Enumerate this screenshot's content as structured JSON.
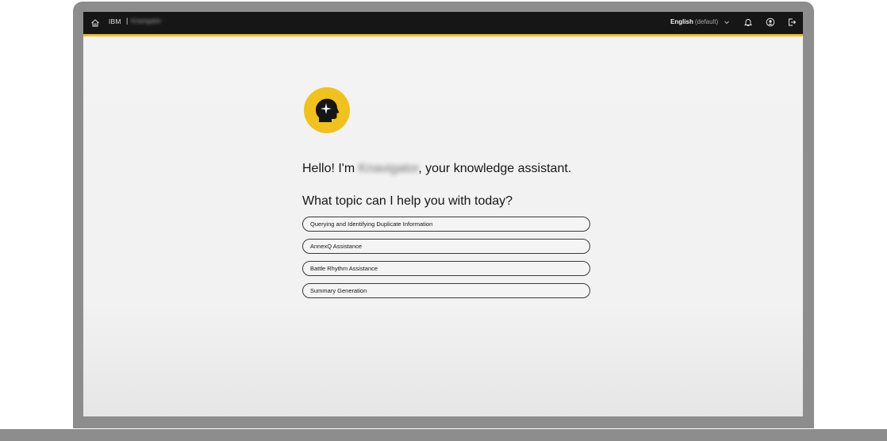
{
  "header": {
    "brand": "IBM",
    "separator": "|",
    "app_name": "Knavigator",
    "language_label": "English",
    "language_suffix": "(default)"
  },
  "icons": {
    "home": "home-icon",
    "chevron": "chevron-down-icon",
    "notifications": "bell-icon",
    "user": "user-avatar-icon",
    "logout": "logout-icon",
    "assistant": "head-sparkle-icon"
  },
  "main": {
    "greeting_prefix": "Hello! I'm ",
    "assistant_name": "Knavigator",
    "greeting_suffix": ", your knowledge assistant.",
    "question": "What topic can I help you with today?",
    "topics": [
      {
        "label": "Querying and Identifying Duplicate Information"
      },
      {
        "label": "AnnexQ Assistance"
      },
      {
        "label": "Battle Rhythm Assistance"
      },
      {
        "label": "Summary Generation"
      }
    ]
  },
  "colors": {
    "accent": "#f1c21b",
    "header_bg": "#161616",
    "page_bg": "#f3f3f3",
    "device_frame": "#8d8d8d"
  }
}
